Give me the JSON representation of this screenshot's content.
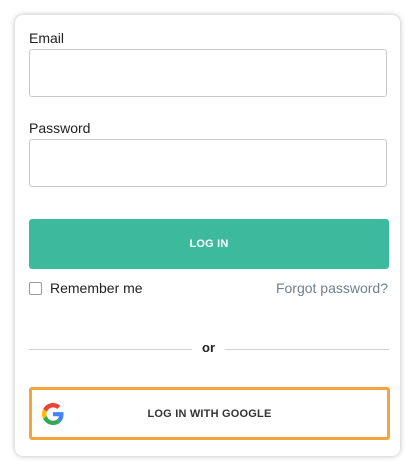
{
  "form": {
    "email_label": "Email",
    "email_value": "",
    "password_label": "Password",
    "password_value": "",
    "login_button": "LOG IN",
    "remember_label": "Remember me",
    "remember_checked": false,
    "forgot_link": "Forgot password?",
    "divider_text": "or",
    "google_button": "LOG IN WITH GOOGLE"
  },
  "colors": {
    "primary": "#3dba9e",
    "focus_outline": "#f3a43b",
    "link": "#6f7f8f"
  },
  "icons": {
    "google": "google-g-icon"
  }
}
